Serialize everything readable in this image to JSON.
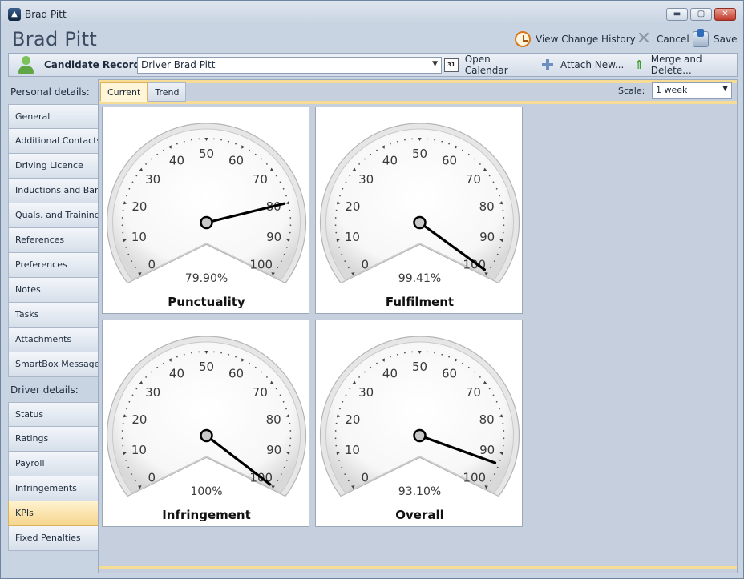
{
  "window": {
    "title": "Brad Pitt",
    "min_glyph": "▬",
    "max_glyph": "▢",
    "close_glyph": "✕"
  },
  "header": {
    "title": "Brad Pitt",
    "actions": {
      "history": "View Change History",
      "cancel": "Cancel",
      "save": "Save"
    }
  },
  "record_bar": {
    "label": "Candidate Records:",
    "selected": "Driver Brad Pitt",
    "calendar_icon_text": "31",
    "open_calendar": "Open Calendar",
    "attach_new": "Attach New...",
    "merge_delete": "Merge and Delete..."
  },
  "sidebar": {
    "personal_header": "Personal details:",
    "personal_items": [
      "General",
      "Additional Contacts",
      "Driving Licence",
      "Inductions and Bans",
      "Quals. and Training",
      "References",
      "Preferences",
      "Notes",
      "Tasks",
      "Attachments",
      "SmartBox Messages"
    ],
    "driver_header": "Driver details:",
    "driver_items": [
      "Status",
      "Ratings",
      "Payroll",
      "Infringements",
      "KPIs",
      "Fixed Penalties"
    ],
    "active_item": "KPIs"
  },
  "tabs": {
    "current": "Current",
    "trend": "Trend",
    "active": "Current"
  },
  "scale": {
    "label": "Scale:",
    "value": "1 week"
  },
  "gauge_ticks": [
    "0",
    "10",
    "20",
    "30",
    "40",
    "50",
    "60",
    "70",
    "80",
    "90",
    "100"
  ],
  "gauges": [
    {
      "name": "Punctuality",
      "value": 79.9,
      "display": "79.90%"
    },
    {
      "name": "Fulfilment",
      "value": 99.41,
      "display": "99.41%"
    },
    {
      "name": "Infringement",
      "value": 100,
      "display": "100%"
    },
    {
      "name": "Overall",
      "value": 93.1,
      "display": "93.10%"
    }
  ],
  "colors": {
    "accent": "#f6dc95",
    "active_item": "#f5d58d",
    "panel": "#c5cfdd"
  }
}
